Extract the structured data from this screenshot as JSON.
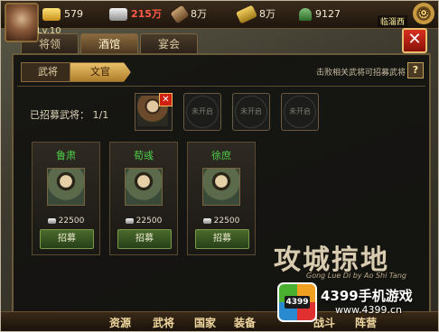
{
  "header": {
    "level": "Lv.10",
    "resources": [
      {
        "icon": "gold-ingot-icon",
        "value": "579"
      },
      {
        "icon": "silver-icon",
        "value": "215万",
        "warn": true
      },
      {
        "icon": "scroll-icon",
        "value": "8万"
      },
      {
        "icon": "grain-icon",
        "value": "8万"
      },
      {
        "icon": "soldier-icon",
        "value": "9127"
      }
    ],
    "city": "临淄西"
  },
  "main_tabs": [
    {
      "label": "将领",
      "active": false
    },
    {
      "label": "酒馆",
      "active": true
    },
    {
      "label": "宴会",
      "active": false
    }
  ],
  "sub_tabs": [
    {
      "label": "武将",
      "active": false
    },
    {
      "label": "文官",
      "active": true
    }
  ],
  "hint": "击败相关武将可招募武将",
  "recruited": {
    "label": "已招募武将：",
    "count": "1/1"
  },
  "slots": [
    {
      "type": "filled"
    },
    {
      "type": "locked",
      "label": "未开启"
    },
    {
      "type": "locked",
      "label": "未开启"
    },
    {
      "type": "locked",
      "label": "未开启"
    }
  ],
  "generals": [
    {
      "name": "鲁肃",
      "cost": "22500",
      "button": "招募"
    },
    {
      "name": "荀彧",
      "cost": "22500",
      "button": "招募"
    },
    {
      "name": "徐庶",
      "cost": "22500",
      "button": "招募"
    }
  ],
  "game_logo": {
    "title": "攻城掠地",
    "subtitle": "Gong Lue Di by Ao Shi Tang"
  },
  "bottom_nav": [
    "资源",
    "武将",
    "国家",
    "装备",
    "战斗",
    "阵营"
  ],
  "watermark": {
    "badge": "4399",
    "line1": "4399手机游戏",
    "line2": "www.4399.cn"
  },
  "colors": {
    "accent": "#e8c06a",
    "name_green": "#4ed04a",
    "warn_red": "#ff5a4a"
  }
}
